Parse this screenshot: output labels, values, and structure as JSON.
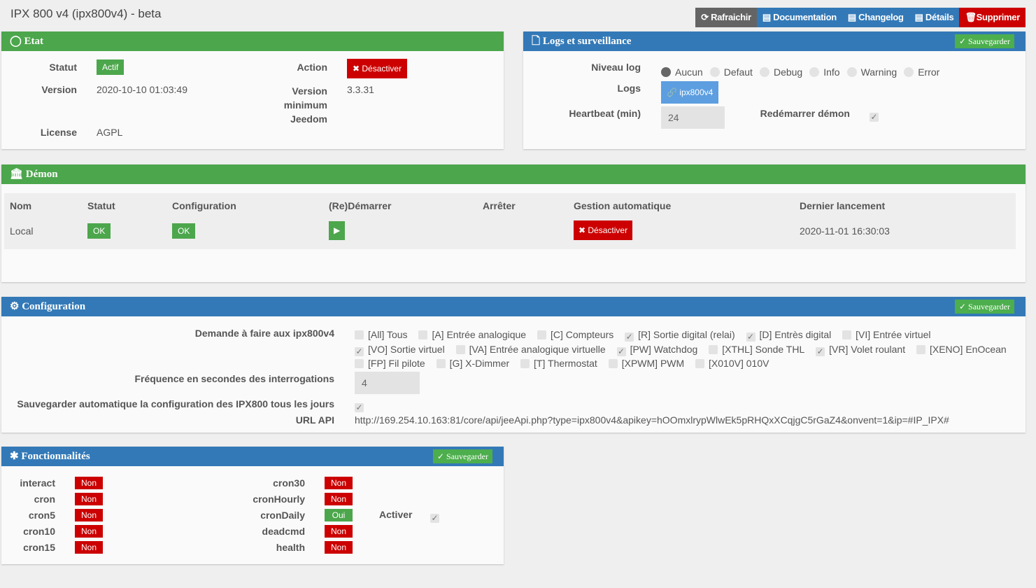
{
  "title": "IPX 800 v4 (ipx800v4) - beta",
  "toolbar": {
    "refresh": "Rafraichir",
    "doc": "Documentation",
    "changelog": "Changelog",
    "details": "Détails",
    "delete": "Supprimer"
  },
  "etat": {
    "title": "Etat",
    "statut_label": "Statut",
    "statut": "Actif",
    "action_label": "Action",
    "action": "Désactiver",
    "version_label": "Version",
    "version": "2020-10-10 01:03:49",
    "min_label": "Version minimum Jeedom",
    "min": "3.3.31",
    "license_label": "License",
    "license": "AGPL"
  },
  "logs": {
    "title": "Logs et surveillance",
    "save": "Sauvegarder",
    "level_label": "Niveau log",
    "levels": [
      "Aucun",
      "Defaut",
      "Debug",
      "Info",
      "Warning",
      "Error"
    ],
    "selected": "Aucun",
    "logs_label": "Logs",
    "log_button": "ipx800v4",
    "heartbeat_label": "Heartbeat (min)",
    "heartbeat": "24",
    "restart_label": "Redémarrer démon",
    "restart_checked": true
  },
  "demon": {
    "title": "Démon",
    "headers": [
      "Nom",
      "Statut",
      "Configuration",
      "(Re)Démarrer",
      "Arrêter",
      "Gestion automatique",
      "Dernier lancement"
    ],
    "name": "Local",
    "statut": "OK",
    "config": "OK",
    "auto": "Désactiver",
    "last": "2020-11-01 16:30:03"
  },
  "config": {
    "title": "Configuration",
    "save": "Sauvegarder",
    "demande_label": "Demande à faire aux ipx800v4",
    "options": [
      {
        "l": "[All] Tous",
        "c": false
      },
      {
        "l": "[A] Entrée analogique",
        "c": false
      },
      {
        "l": "[C] Compteurs",
        "c": false
      },
      {
        "l": "[R] Sortie digital (relai)",
        "c": true
      },
      {
        "l": "[D] Entrès digital",
        "c": true
      },
      {
        "l": "[VI] Entrée virtuel",
        "c": false
      },
      {
        "l": "[VO] Sortie virtuel",
        "c": true
      },
      {
        "l": "[VA] Entrée analogique virtuelle",
        "c": false
      },
      {
        "l": "[PW] Watchdog",
        "c": true
      },
      {
        "l": "[XTHL] Sonde THL",
        "c": false
      },
      {
        "l": "[VR] Volet roulant",
        "c": true
      },
      {
        "l": "[XENO] EnOcean",
        "c": false
      },
      {
        "l": "[FP] Fil pilote",
        "c": false
      },
      {
        "l": "[G] X-Dimmer",
        "c": false
      },
      {
        "l": "[T] Thermostat",
        "c": false
      },
      {
        "l": "[XPWM] PWM",
        "c": false
      },
      {
        "l": "[X010V] 010V",
        "c": false
      }
    ],
    "freq_label": "Fréquence en secondes des interrogations",
    "freq": "4",
    "autosave_label": "Sauvegarder automatique la configuration des IPX800 tous les jours",
    "url_label": "URL API",
    "url": "http://169.254.10.163:81/core/api/jeeApi.php?type=ipx800v4&apikey=hOOmxlrypWlwEk5pRHQxXCqjgC5rGaZ4&onvent=1&ip=#IP_IPX#"
  },
  "fonc": {
    "title": "Fonctionnalités",
    "save": "Sauvegarder",
    "col1": [
      [
        "interact",
        "Non"
      ],
      [
        "cron",
        "Non"
      ],
      [
        "cron5",
        "Non"
      ],
      [
        "cron10",
        "Non"
      ],
      [
        "cron15",
        "Non"
      ]
    ],
    "col2": [
      [
        "cron30",
        "Non"
      ],
      [
        "cronHourly",
        "Non"
      ],
      [
        "cronDaily",
        "Oui"
      ],
      [
        "deadcmd",
        "Non"
      ],
      [
        "health",
        "Non"
      ]
    ],
    "activer_label": "Activer"
  },
  "colors": {
    "green": "#4ca64c",
    "blue": "#3379b7",
    "red": "#cc0000"
  }
}
